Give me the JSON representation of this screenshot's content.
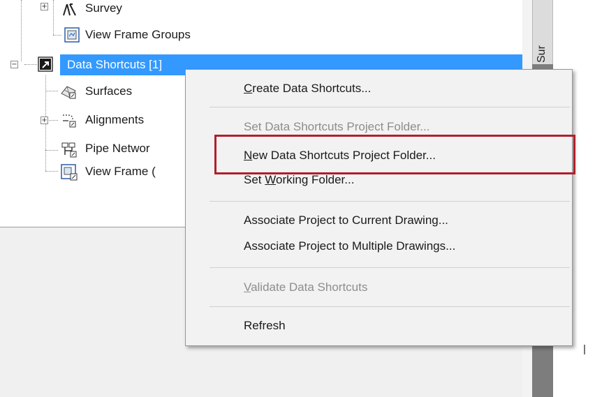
{
  "tree": {
    "items": [
      {
        "label": "Survey",
        "expander": "+",
        "icon": "survey-icon"
      },
      {
        "label": "View Frame Groups",
        "expander": "",
        "icon": "view-frame-groups-icon"
      },
      {
        "label": "Data Shortcuts [1]",
        "expander": "−",
        "icon": "data-shortcuts-icon",
        "selected": true
      },
      {
        "label": "Surfaces",
        "expander": "",
        "icon": "surfaces-icon"
      },
      {
        "label": "Alignments",
        "expander": "+",
        "icon": "alignments-icon"
      },
      {
        "label": "Pipe Networ",
        "expander": "",
        "icon": "pipe-networks-icon"
      },
      {
        "label": "View Frame (",
        "expander": "",
        "icon": "view-frame-icon"
      }
    ]
  },
  "right_tab": {
    "label": "Sur"
  },
  "context_menu": {
    "items": [
      {
        "label": "Create Data Shortcuts...",
        "mnemonic": "C",
        "enabled": true
      },
      {
        "label": "Set Data Shortcuts Project Folder...",
        "enabled": false
      },
      {
        "label": "New Data Shortcuts Project Folder...",
        "mnemonic": "N",
        "enabled": true,
        "highlighted": true
      },
      {
        "label": "Set Working Folder...",
        "mnemonic": "W",
        "enabled": true
      },
      {
        "label": "Associate Project to Current Drawing...",
        "enabled": true
      },
      {
        "label": "Associate Project to Multiple Drawings...",
        "enabled": true
      },
      {
        "label": "Validate Data Shortcuts",
        "mnemonic": "V",
        "enabled": false
      },
      {
        "label": "Refresh",
        "enabled": true
      }
    ]
  },
  "colors": {
    "selection": "#3399ff",
    "highlight_border": "#b0202a",
    "menu_background": "#f2f2f2",
    "disabled_text": "#8d8d8d"
  }
}
